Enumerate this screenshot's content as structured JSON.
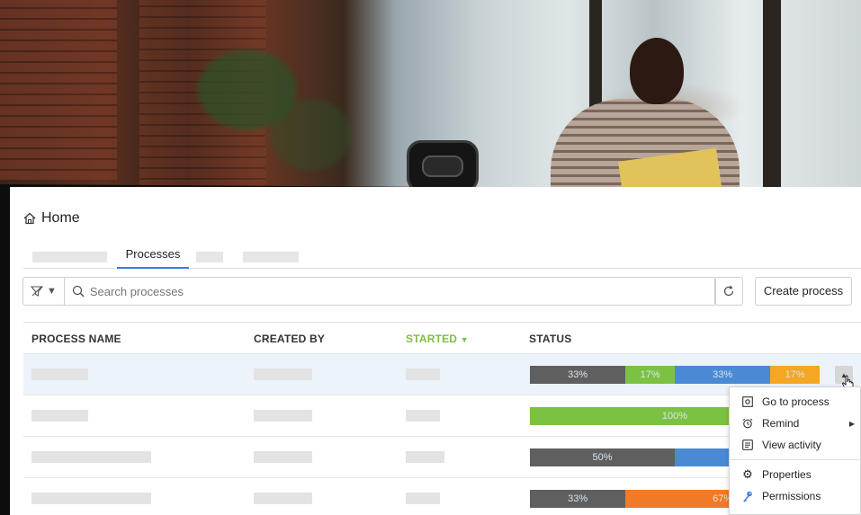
{
  "header": {
    "title": "Home"
  },
  "tabs": {
    "active_label": "Processes"
  },
  "toolbar": {
    "search_placeholder": "Search processes",
    "create_label": "Create process"
  },
  "table": {
    "columns": {
      "name": "PROCESS NAME",
      "created_by": "CREATED BY",
      "started": "STARTED",
      "status": "STATUS"
    },
    "sort_column": "STARTED",
    "rows": [
      {
        "status": [
          {
            "label": "33%",
            "value": 33,
            "color": "#5f5f5f"
          },
          {
            "label": "17%",
            "value": 17,
            "color": "#7cc242"
          },
          {
            "label": "33%",
            "value": 33,
            "color": "#4a8ad4"
          },
          {
            "label": "17%",
            "value": 17,
            "color": "#f5a623"
          }
        ]
      },
      {
        "status": [
          {
            "label": "100%",
            "value": 100,
            "color": "#7cc242"
          }
        ]
      },
      {
        "status": [
          {
            "label": "50%",
            "value": 50,
            "color": "#5f5f5f"
          },
          {
            "label": "50%",
            "value": 50,
            "color": "#4a8ad4"
          }
        ]
      },
      {
        "status": [
          {
            "label": "33%",
            "value": 33,
            "color": "#5f5f5f"
          },
          {
            "label": "67%",
            "value": 67,
            "color": "#f07a28"
          }
        ]
      }
    ]
  },
  "context_menu": {
    "items": {
      "go_to_process": "Go to process",
      "remind": "Remind",
      "view_activity": "View activity",
      "properties": "Properties",
      "permissions": "Permissions"
    }
  },
  "colors": {
    "accent_blue": "#3f7dd1",
    "sort_green": "#7cbe45"
  }
}
